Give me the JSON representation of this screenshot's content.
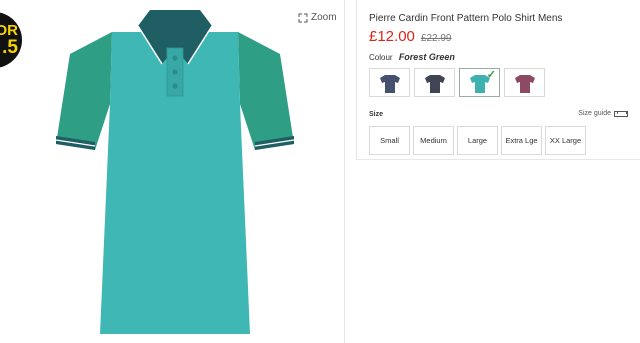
{
  "promo": {
    "line1": "OR",
    "line2": ".5"
  },
  "zoom": {
    "label": "Zoom",
    "icon": "expand-icon"
  },
  "product": {
    "title": "Pierre Cardin Front Pattern Polo Shirt Mens",
    "price_now": "£12.00",
    "price_was": "£22.99",
    "colour_label": "Colour",
    "colour_value": "Forest Green",
    "swatches": [
      {
        "name": "Navy",
        "color": "#44506d",
        "selected": false
      },
      {
        "name": "Charcoal",
        "color": "#3f4552",
        "selected": false
      },
      {
        "name": "Forest Green",
        "color": "#3fb0b0",
        "selected": true
      },
      {
        "name": "Burgundy",
        "color": "#8c4a66",
        "selected": false
      }
    ],
    "size_label": "Size",
    "size_guide_label": "Size guide",
    "sizes": [
      "Small",
      "Medium",
      "Large",
      "Extra Lge",
      "XX Large"
    ]
  },
  "colors": {
    "price_red": "#d9261c",
    "shirt_body": "#3fb7b4",
    "shirt_sleeve": "#2e9e84",
    "collar": "#1f5e63"
  }
}
